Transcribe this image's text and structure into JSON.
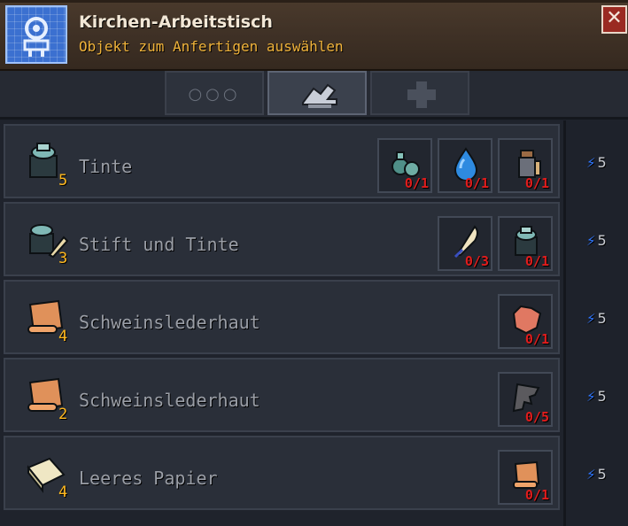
{
  "header": {
    "title": "Kirchen-Arbeitstisch",
    "subtitle": "Objekt zum Anfertigen auswählen",
    "close_label": "✕"
  },
  "tabs": [
    {
      "name": "more",
      "label": "○○○",
      "selected": false
    },
    {
      "name": "crafting",
      "selected": true
    },
    {
      "name": "add",
      "selected": false
    }
  ],
  "recipes": [
    {
      "label": "Tinte",
      "count": "5",
      "cost": "5",
      "ingredients": [
        {
          "icon": "green-bottles-icon",
          "qty": "0/1"
        },
        {
          "icon": "water-drop-icon",
          "qty": "0/1"
        },
        {
          "icon": "potion-flask-icon",
          "qty": "0/1"
        }
      ]
    },
    {
      "label": "Stift und Tinte",
      "count": "3",
      "cost": "5",
      "ingredients": [
        {
          "icon": "quill-icon",
          "qty": "0/3"
        },
        {
          "icon": "ink-pot-icon",
          "qty": "0/1"
        }
      ]
    },
    {
      "label": "Schweinslederhaut",
      "count": "4",
      "cost": "5",
      "ingredients": [
        {
          "icon": "pig-hide-icon",
          "qty": "0/1"
        }
      ]
    },
    {
      "label": "Schweinslederhaut",
      "count": "2",
      "cost": "5",
      "ingredients": [
        {
          "icon": "bat-wing-icon",
          "qty": "0/5"
        }
      ]
    },
    {
      "label": "Leeres Papier",
      "count": "4",
      "cost": "5",
      "ingredients": [
        {
          "icon": "scroll-icon",
          "qty": "0/1"
        }
      ]
    }
  ],
  "colors": {
    "header_bg": "#3e3025",
    "title": "#f2e7d6",
    "subtitle": "#f0b33a",
    "count": "#ffb81e",
    "qty_missing": "#e01c1c",
    "energy": "#2e76ff"
  }
}
